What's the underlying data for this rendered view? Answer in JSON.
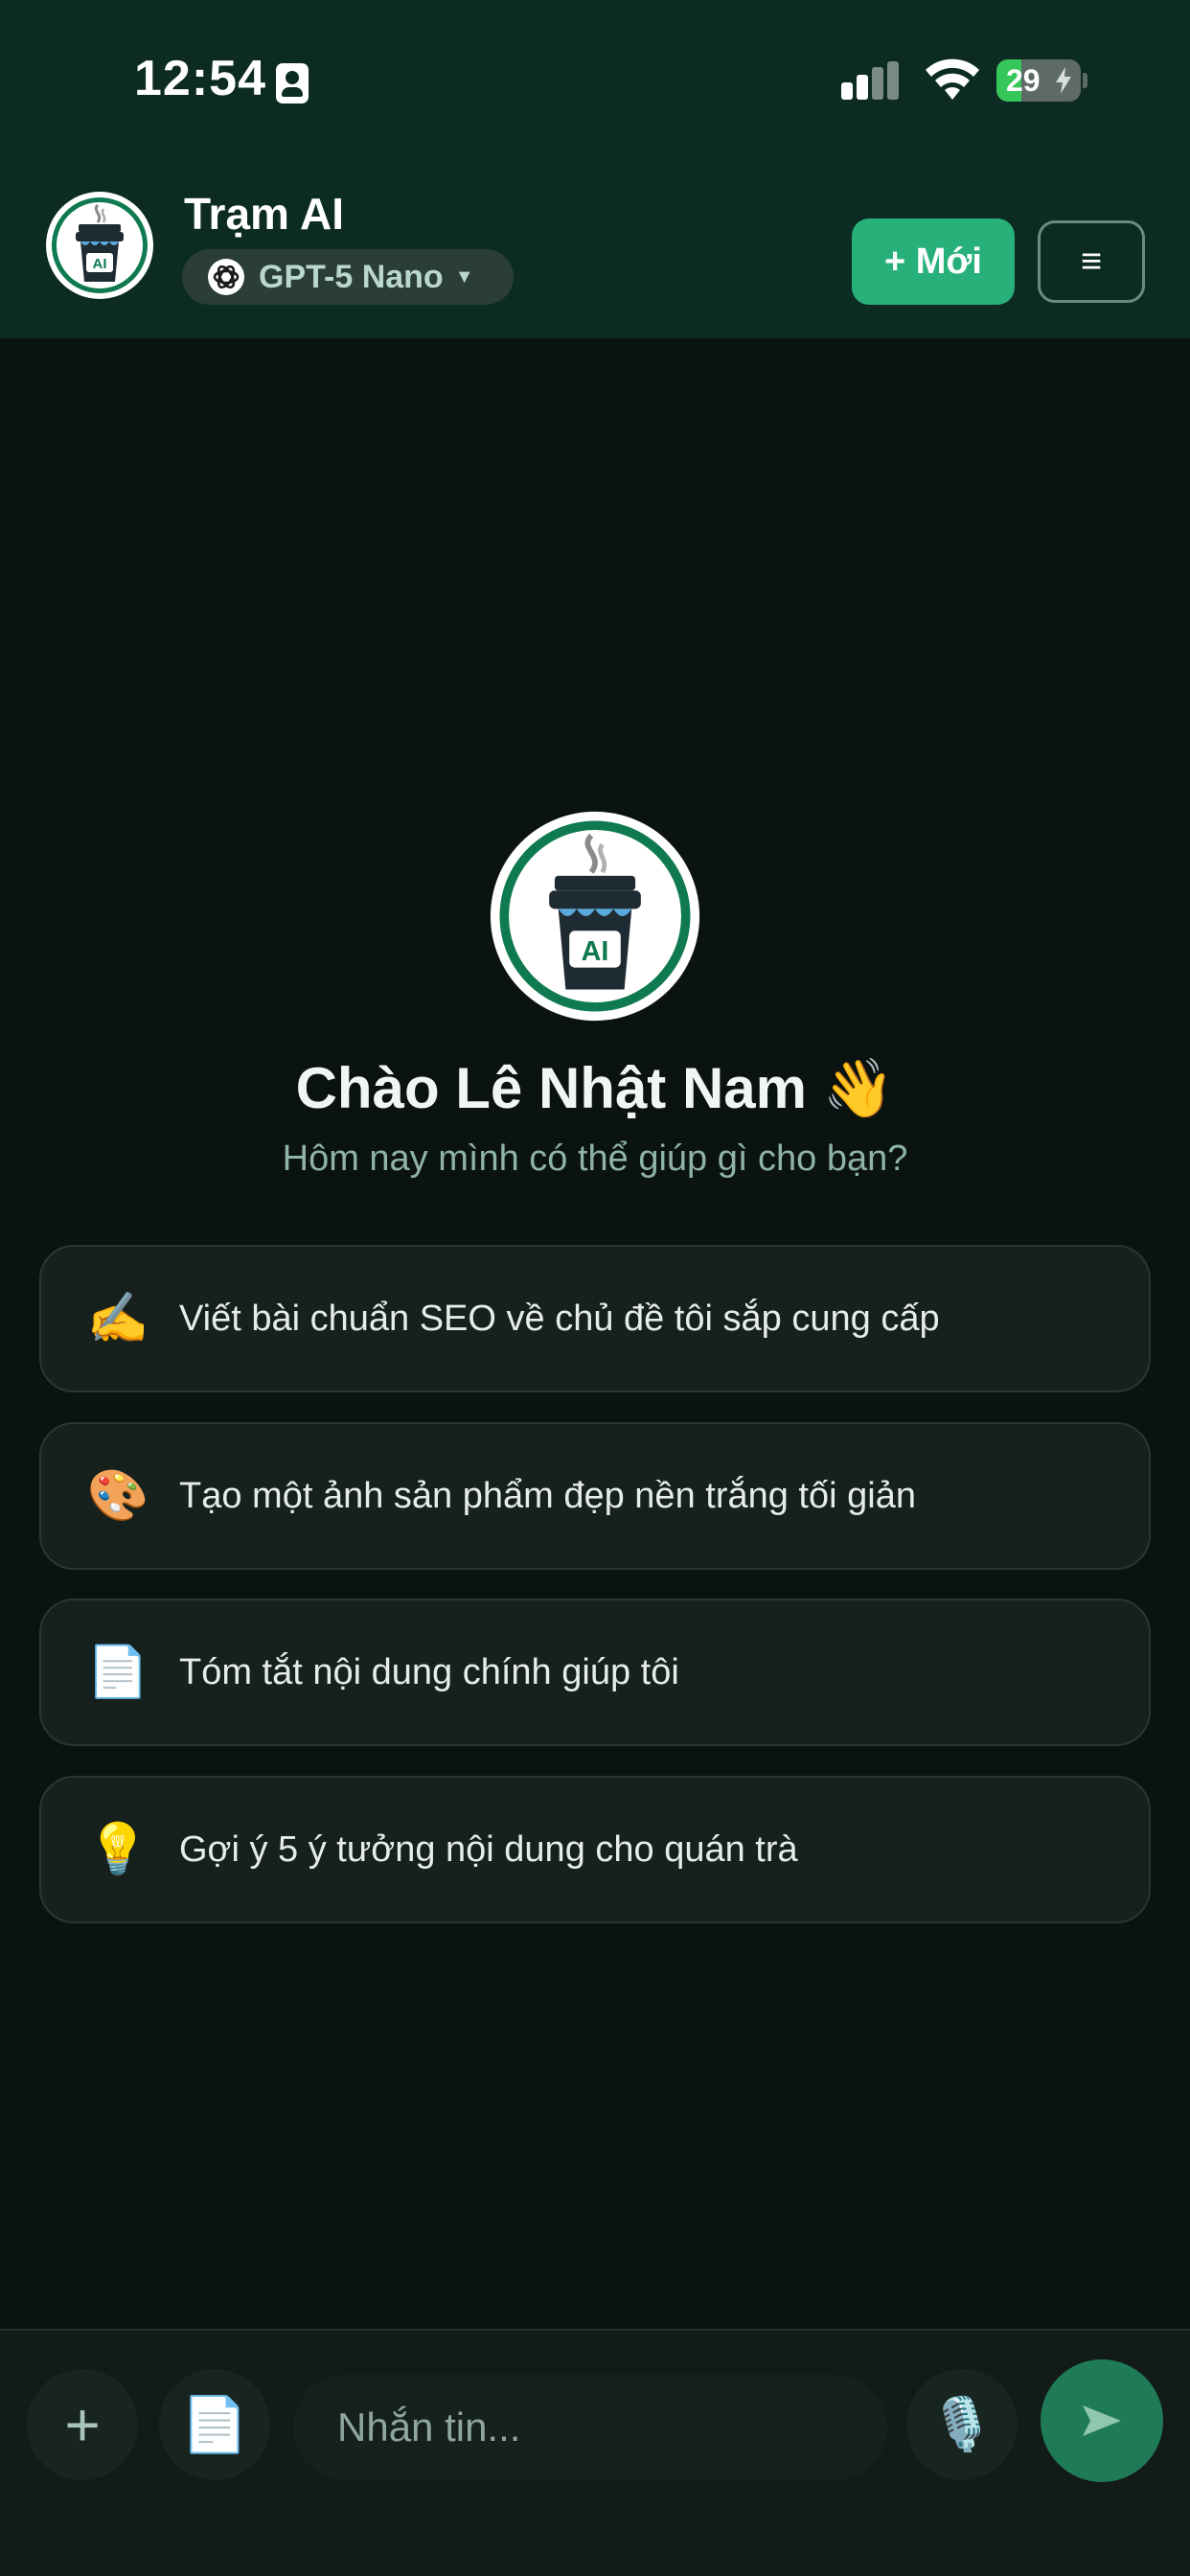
{
  "status_bar": {
    "time": "12:54",
    "battery_level": "29",
    "battery_fraction": 0.29
  },
  "header": {
    "title": "Trạm AI",
    "model": "GPT-5 Nano",
    "new_label": "+ Mới",
    "menu_icon": "≡",
    "logo_text": "AI"
  },
  "hero": {
    "greeting": "Chào Lê Nhật Nam 👋",
    "subtitle": "Hôm nay mình có thể giúp gì cho bạn?",
    "logo_text": "AI"
  },
  "suggestions": [
    {
      "emoji": "✍️",
      "icon": "writing-hand-icon",
      "text": "Viết bài chuẩn SEO về chủ đề tôi sắp cung cấp"
    },
    {
      "emoji": "🎨",
      "icon": "palette-icon",
      "text": "Tạo một ảnh sản phẩm đẹp nền trắng tối giản"
    },
    {
      "emoji": "📄",
      "icon": "document-icon",
      "text": "Tóm tắt nội dung chính giúp tôi"
    },
    {
      "emoji": "💡",
      "icon": "lightbulb-icon",
      "text": "Gợi ý 5 ý tưởng nội dung cho quán trà"
    }
  ],
  "composer": {
    "placeholder": "Nhắn tin...",
    "plus_label": "+",
    "file_emoji": "📄",
    "mic_emoji": "🎙️"
  },
  "colors": {
    "accent": "#27b07a",
    "header_bg": "#0c2b23",
    "page_bg": "#0b1311",
    "card_bg": "#16201d"
  }
}
